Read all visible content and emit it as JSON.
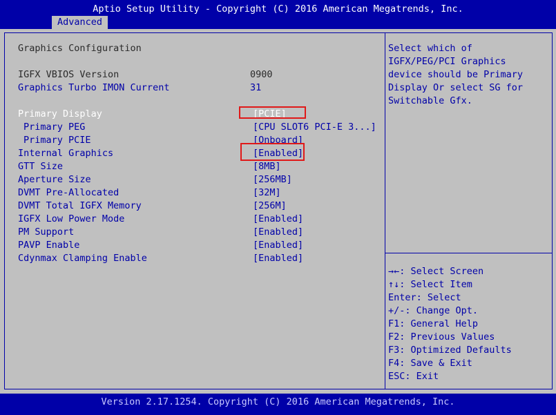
{
  "header": {
    "title": "Aptio Setup Utility - Copyright (C) 2016 American Megatrends, Inc.",
    "active_tab": "Advanced"
  },
  "section_title": "Graphics Configuration",
  "info": [
    {
      "label": "IGFX VBIOS Version",
      "value": "0900"
    },
    {
      "label": "Graphics Turbo IMON Current",
      "value": "31"
    }
  ],
  "settings": [
    {
      "label": "Primary Display",
      "value": "[PCIE]",
      "selected": true
    },
    {
      "label": "Primary PEG",
      "value": "[CPU SLOT6 PCI-E 3...]"
    },
    {
      "label": "Primary PCIE",
      "value": "[Onboard]"
    },
    {
      "label": "Internal Graphics",
      "value": "[Enabled]"
    },
    {
      "label": "GTT Size",
      "value": "[8MB]"
    },
    {
      "label": "Aperture Size",
      "value": "[256MB]"
    },
    {
      "label": "DVMT Pre-Allocated",
      "value": "[32M]"
    },
    {
      "label": "DVMT Total IGFX Memory",
      "value": "[256M]"
    },
    {
      "label": "IGFX Low Power Mode",
      "value": "[Enabled]"
    },
    {
      "label": "PM Support",
      "value": "[Enabled]"
    },
    {
      "label": "PAVP Enable",
      "value": "[Enabled]"
    },
    {
      "label": "Cdynmax Clamping Enable",
      "value": "[Enabled]"
    }
  ],
  "help": {
    "lines": [
      "Select which of",
      "IGFX/PEG/PCI Graphics",
      "device should be Primary",
      "Display Or select SG for",
      "Switchable Gfx."
    ]
  },
  "keys": [
    "→←: Select Screen",
    "↑↓: Select Item",
    "Enter: Select",
    "+/-: Change Opt.",
    "F1: General Help",
    "F2: Previous Values",
    "F3: Optimized Defaults",
    "F4: Save & Exit",
    "ESC: Exit"
  ],
  "footer": {
    "version": "Version 2.17.1254. Copyright (C) 2016 American Megatrends, Inc."
  },
  "colors": {
    "bar_blue": "#0000a8",
    "panel_gray": "#c0c0c0",
    "highlight_red": "#e01818"
  }
}
